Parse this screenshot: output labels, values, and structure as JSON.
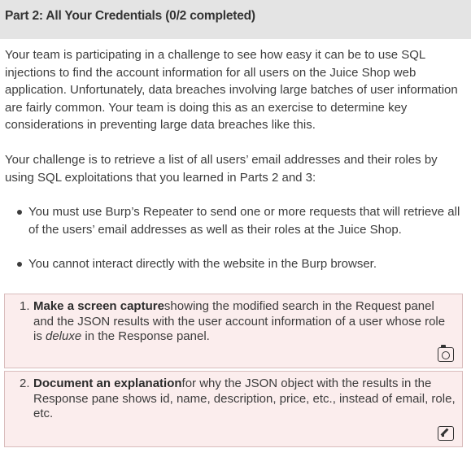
{
  "header": {
    "title": "Part 2: All Your Credentials (0/2 completed)"
  },
  "intro": {
    "paragraph1": "Your team is participating in a challenge to see how easy it can be to use SQL injections to find the account information for all users on the Juice Shop web application. Unfortunately, data breaches involving large batches of user information are fairly common. Your team is doing this as an exercise to determine key considerations in preventing large data breaches like this.",
    "paragraph2": "Your challenge is to retrieve a list of all users’ email addresses and their roles by using SQL exploitations that you learned in Parts 2 and 3:"
  },
  "bullets": [
    "You must use Burp’s Repeater to send one or more requests that will retrieve all of the users’ email addresses as well as their roles at the Juice Shop.",
    "You cannot interact directly with the website in the Burp browser."
  ],
  "tasks": [
    {
      "number": "1.",
      "bold": "Make a screen capture",
      "text_before_em": "showing the modified search in the Request panel and the JSON results with the user account information of a user whose role is ",
      "em": "deluxe",
      "text_after_em": " in the Response panel.",
      "icon": "camera-icon"
    },
    {
      "number": "2.",
      "bold": "Document an explanation",
      "text": "for why the JSON object with the results in the Response pane shows id, name, description, price, etc., instead of email, role, etc.",
      "icon": "edit-icon"
    }
  ]
}
